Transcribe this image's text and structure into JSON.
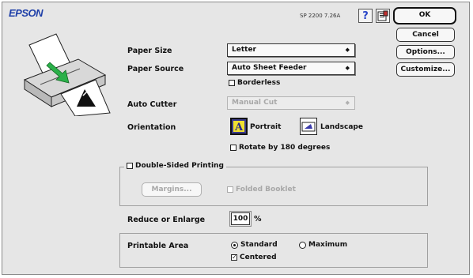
{
  "header": {
    "brand": "EPSON",
    "model": "SP 2200 7.26A",
    "help_glyph": "?",
    "help_icon": "question-mark-icon",
    "info_icon": "printer-info-icon"
  },
  "buttons": {
    "ok": "OK",
    "cancel": "Cancel",
    "options": "Options...",
    "customize": "Customize..."
  },
  "paper_size": {
    "label": "Paper Size",
    "value": "Letter"
  },
  "paper_source": {
    "label": "Paper Source",
    "value": "Auto Sheet Feeder"
  },
  "borderless": {
    "label": "Borderless",
    "checked": false
  },
  "auto_cutter": {
    "label": "Auto Cutter",
    "value": "Manual Cut",
    "enabled": false
  },
  "orientation": {
    "label": "Orientation",
    "portrait_label": "Portrait",
    "landscape_label": "Landscape",
    "selected": "Portrait",
    "rotate_label": "Rotate by 180 degrees",
    "rotate_checked": false
  },
  "double_sided": {
    "label": "Double-Sided Printing",
    "checked": false,
    "margins_label": "Margins...",
    "folded_label": "Folded Booklet",
    "folded_checked": false
  },
  "reduce": {
    "label": "Reduce or Enlarge",
    "value": "100",
    "unit": "%"
  },
  "printable_area": {
    "label": "Printable Area",
    "standard_label": "Standard",
    "maximum_label": "Maximum",
    "selected": "Standard",
    "centered_label": "Centered",
    "centered_checked": true
  },
  "colors": {
    "brand": "#1e3fa8",
    "help": "#2a46c8",
    "arrow": "#2bb04a"
  }
}
